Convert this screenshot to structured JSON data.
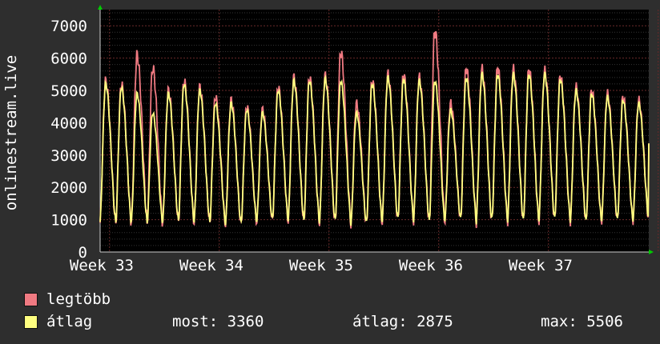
{
  "chart_data": {
    "type": "line",
    "ylabel": "onlinestream.live",
    "ylim": [
      0,
      7500
    ],
    "yticks": [
      0,
      1000,
      2000,
      3000,
      4000,
      5000,
      6000,
      7000
    ],
    "xticks": [
      "Week 33",
      "Week 34",
      "Week 35",
      "Week 36",
      "Week 37"
    ],
    "grid": true,
    "days": 35,
    "series": [
      {
        "name": "legtöbb",
        "color": "#f07a82",
        "daily_peak": [
          5300,
          5200,
          6100,
          5700,
          5000,
          5300,
          5100,
          4800,
          4700,
          4500,
          4400,
          5100,
          5400,
          5400,
          5450,
          6200,
          4600,
          5300,
          5500,
          5500,
          5400,
          6850,
          4600,
          5700,
          5650,
          5700,
          5650,
          5650,
          5600,
          5450,
          5100,
          5000,
          4900,
          4800,
          4700
        ]
      },
      {
        "name": "átlag",
        "color": "#ffff80",
        "daily_peak": [
          5200,
          5100,
          4900,
          4300,
          4900,
          5200,
          5000,
          4600,
          4600,
          4400,
          4300,
          5000,
          5300,
          5300,
          5350,
          5300,
          4300,
          5200,
          5400,
          5350,
          5300,
          5300,
          4400,
          5400,
          5500,
          5500,
          5500,
          5500,
          5500,
          5350,
          5000,
          4900,
          4800,
          4700,
          4600
        ]
      }
    ],
    "daily_trough": [
      900,
      880,
      950,
      850,
      950,
      930,
      900,
      880,
      820,
      900,
      950,
      1000,
      960,
      920,
      900,
      950,
      820,
      900,
      960,
      1000,
      950,
      900,
      1000,
      980,
      900,
      1000,
      960,
      930,
      1000,
      990,
      950,
      900,
      1000,
      950,
      980
    ]
  },
  "legend": {
    "max_label": "legtöbb",
    "avg_label": "átlag"
  },
  "stats": {
    "current": "most: 3360",
    "average": "átlag: 2875",
    "maximum": "max: 5506"
  },
  "colors": {
    "background": "#2e2e2e",
    "plot_background": "#000000",
    "grid": "#555555",
    "axis_arrow": "#00cc00"
  }
}
